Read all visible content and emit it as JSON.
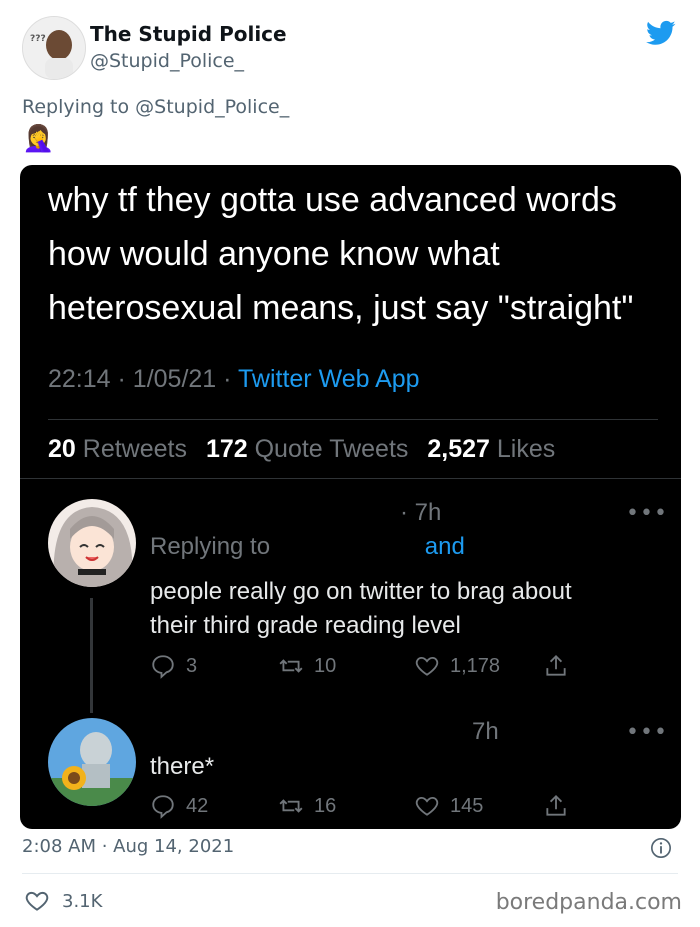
{
  "outer_tweet": {
    "author_name": "The Stupid Police",
    "author_handle": "@Stupid_Police_",
    "replying_prefix": "Replying to",
    "replying_handle": "@Stupid_Police_",
    "emoji": "🤦‍♀️",
    "timestamp": "2:08 AM · Aug 14, 2021",
    "likes": "3.1K",
    "brand_color": "#1d9bf0"
  },
  "embedded": {
    "tweet_text_lines": [
      "why tf they gotta use advanced words",
      "how would anyone know what",
      "heterosexual means, just say \"straight\""
    ],
    "time": "22:14",
    "date": "1/05/21",
    "app": "Twitter Web App",
    "stats": {
      "retweets_count": "20",
      "retweets_label": "Retweets",
      "quotes_count": "172",
      "quotes_label": "Quote Tweets",
      "likes_count": "2,527",
      "likes_label": "Likes"
    },
    "replies": [
      {
        "age": "7h",
        "replying_prefix": "Replying to",
        "replying_and": "and",
        "text_lines": [
          "people really go on twitter to brag about",
          "their third grade reading level"
        ],
        "reply_count": "3",
        "retweet_count": "10",
        "like_count": "1,178"
      },
      {
        "age": "7h",
        "text_lines": [
          "there*"
        ],
        "reply_count": "42",
        "retweet_count": "16",
        "like_count": "145"
      }
    ]
  },
  "watermark": "boredpanda.com",
  "icons": {
    "logo": "twitter-bird-icon",
    "info": "info-icon",
    "like": "heart-icon",
    "reply": "reply-icon",
    "retweet": "retweet-icon",
    "share": "share-icon",
    "more": "more-dots-icon"
  }
}
